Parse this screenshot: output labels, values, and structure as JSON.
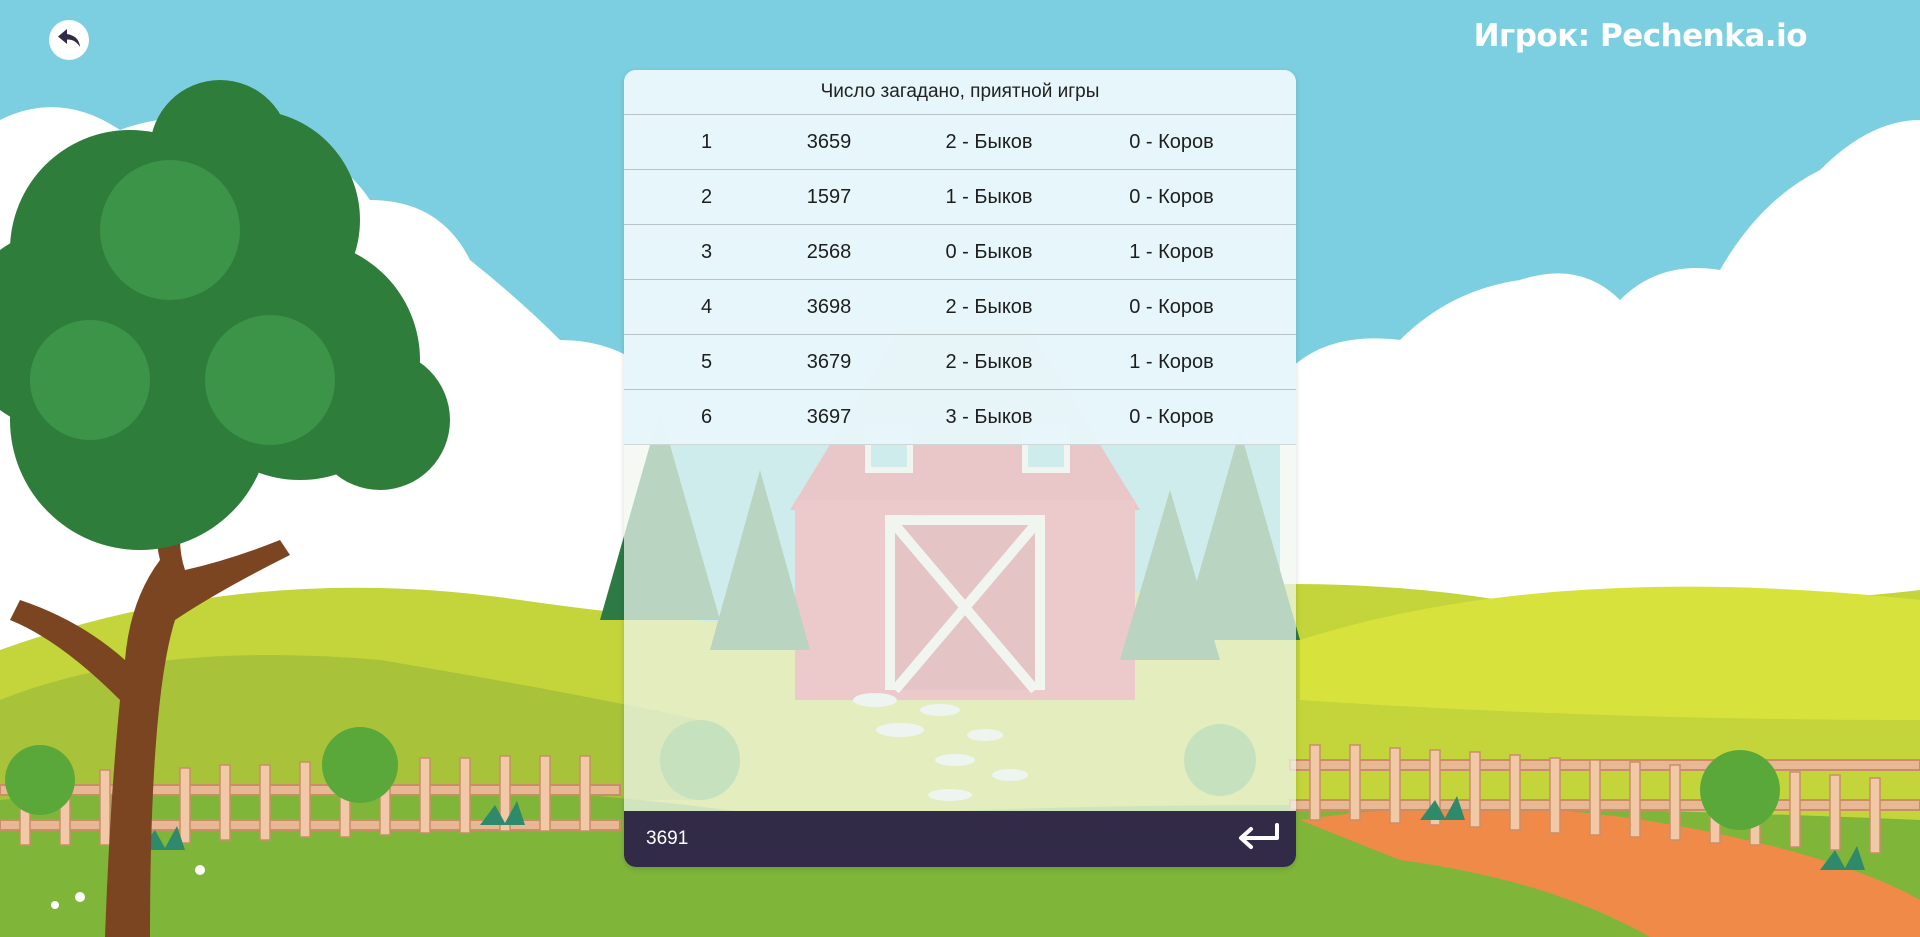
{
  "header": {
    "player_label": "Игрок:",
    "player_name": "Pechenka.io",
    "back_icon": "undo-arrow-icon"
  },
  "game": {
    "status_text": "Число загадано, приятной игры",
    "attempts": [
      {
        "n": "1",
        "guess": "3659",
        "bulls": "2 - Быков",
        "cows": "0 - Коров"
      },
      {
        "n": "2",
        "guess": "1597",
        "bulls": "1 - Быков",
        "cows": "0 - Коров"
      },
      {
        "n": "3",
        "guess": "2568",
        "bulls": "0 - Быков",
        "cows": "1 - Коров"
      },
      {
        "n": "4",
        "guess": "3698",
        "bulls": "2 - Быков",
        "cows": "0 - Коров"
      },
      {
        "n": "5",
        "guess": "3679",
        "bulls": "2 - Быков",
        "cows": "1 - Коров"
      },
      {
        "n": "6",
        "guess": "3697",
        "bulls": "3 - Быков",
        "cows": "0 - Коров"
      }
    ]
  },
  "input": {
    "value": "3691",
    "submit_icon": "enter-return-icon"
  },
  "colors": {
    "sky": "#7ccfe0",
    "input_bar": "#322b48",
    "barn": "#e2556a",
    "grass": "#8fbf3a"
  }
}
